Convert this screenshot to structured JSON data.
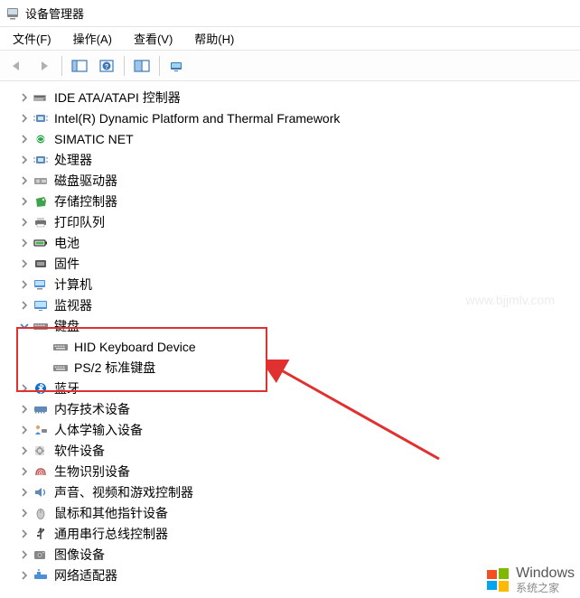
{
  "title": "设备管理器",
  "menu": {
    "file": "文件(F)",
    "action": "操作(A)",
    "view": "查看(V)",
    "help": "帮助(H)"
  },
  "tree": {
    "items": [
      {
        "label": "IDE ATA/ATAPI 控制器",
        "icon": "ide"
      },
      {
        "label": "Intel(R) Dynamic Platform and Thermal Framework",
        "icon": "chip"
      },
      {
        "label": "SIMATIC NET",
        "icon": "net"
      },
      {
        "label": "处理器",
        "icon": "cpu"
      },
      {
        "label": "磁盘驱动器",
        "icon": "disk"
      },
      {
        "label": "存储控制器",
        "icon": "storage"
      },
      {
        "label": "打印队列",
        "icon": "printer"
      },
      {
        "label": "电池",
        "icon": "battery"
      },
      {
        "label": "固件",
        "icon": "firmware"
      },
      {
        "label": "计算机",
        "icon": "computer"
      },
      {
        "label": "监视器",
        "icon": "monitor"
      },
      {
        "label": "键盘",
        "icon": "keyboard",
        "expanded": true,
        "children": [
          {
            "label": "HID Keyboard Device",
            "icon": "keyboard"
          },
          {
            "label": "PS/2 标准键盘",
            "icon": "keyboard"
          }
        ]
      },
      {
        "label": "蓝牙",
        "icon": "bluetooth"
      },
      {
        "label": "内存技术设备",
        "icon": "memory"
      },
      {
        "label": "人体学输入设备",
        "icon": "hid"
      },
      {
        "label": "软件设备",
        "icon": "software"
      },
      {
        "label": "生物识别设备",
        "icon": "bio"
      },
      {
        "label": "声音、视频和游戏控制器",
        "icon": "audio"
      },
      {
        "label": "鼠标和其他指针设备",
        "icon": "mouse"
      },
      {
        "label": "通用串行总线控制器",
        "icon": "usb"
      },
      {
        "label": "图像设备",
        "icon": "image"
      },
      {
        "label": "网络适配器",
        "icon": "network"
      }
    ]
  },
  "watermark": "www.bjjmlv.com",
  "logo": {
    "main": "Windows",
    "sub": "系统之家"
  }
}
